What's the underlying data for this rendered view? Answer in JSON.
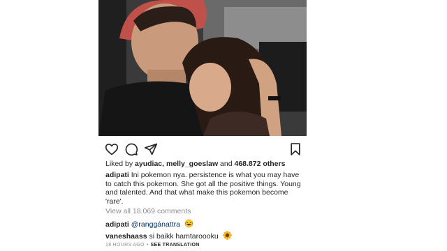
{
  "post": {
    "likes": {
      "prefix": "Liked by",
      "user1": "ayudiac,",
      "user2": "melly_goeslaw",
      "connector": "and",
      "others": "468.872 others"
    },
    "caption": {
      "username": "adipati",
      "text": "Ini pokemon nya. persistence is what you may have to catch this pokemon. She got all the positive things. Young and talented. And that what make this pokemon become 'rare'."
    },
    "view_all_comments": "View all 18.069 comments",
    "comments": [
      {
        "username": "adipati",
        "text": "@ranggánattra",
        "emoji": "laughing-emoji"
      },
      {
        "username": "vaneshaass",
        "text": "si baikk hamtaroooku",
        "emoji": "sunflower-emoji"
      }
    ],
    "timestamp": "18 HOURS AGO",
    "separator": "•",
    "see_translation": "SEE TRANSLATION"
  },
  "icons": {
    "like": "heart-icon",
    "comment": "comment-bubble-icon",
    "share": "paper-plane-icon",
    "save": "bookmark-icon"
  }
}
